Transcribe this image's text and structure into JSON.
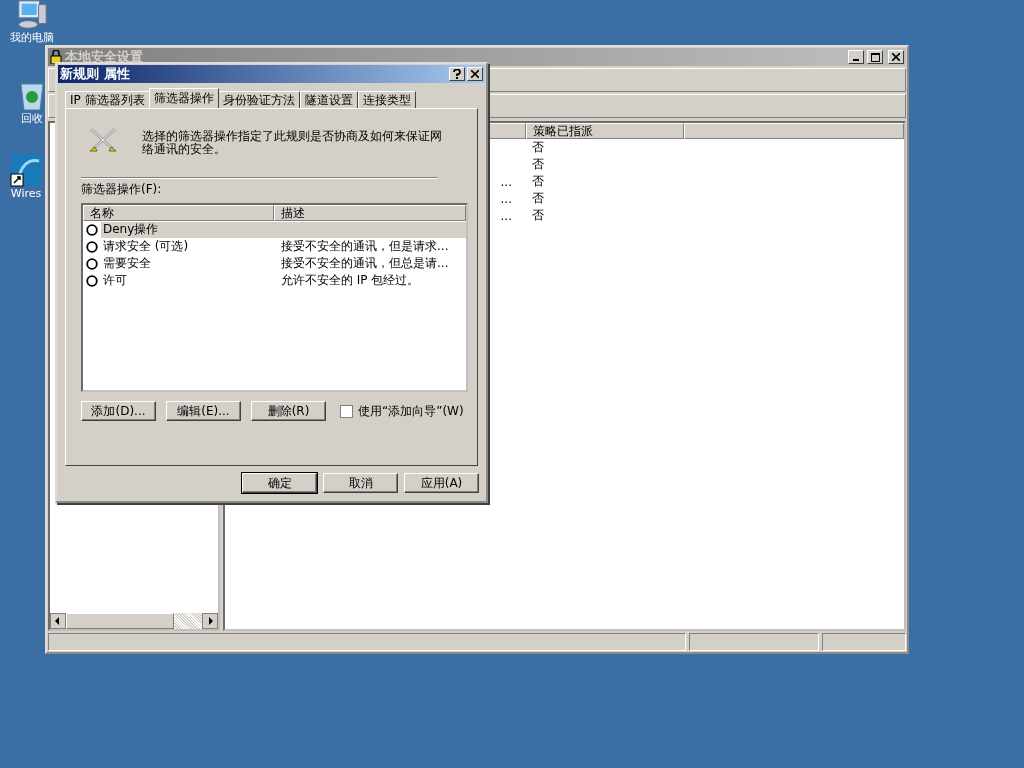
{
  "desktop_icons": [
    {
      "kind": "computer",
      "label": "我的电脑"
    },
    {
      "kind": "recycle",
      "label": "回收"
    },
    {
      "kind": "shark",
      "label": "Wires"
    }
  ],
  "main_window": {
    "title": "本地安全设置",
    "table": {
      "columns": [
        "策略已指派"
      ],
      "rows": [
        {
          "column_1": "",
          "assigned": "否"
        },
        {
          "column_1": "",
          "assigned": "否"
        },
        {
          "column_1": "...",
          "assigned": "否"
        },
        {
          "column_1": "...",
          "assigned": "否"
        },
        {
          "column_1": "...",
          "assigned": "否"
        }
      ]
    }
  },
  "dialog": {
    "title": "新规则 属性",
    "tabs": [
      {
        "label": "IP 筛选器列表",
        "selected": false
      },
      {
        "label": "筛选器操作",
        "selected": true
      },
      {
        "label": "身份验证方法",
        "selected": false
      },
      {
        "label": "隧道设置",
        "selected": false
      },
      {
        "label": "连接类型",
        "selected": false
      }
    ],
    "description": "选择的筛选器操作指定了此规则是否协商及如何来保证网络通讯的安全。",
    "list_label": "筛选器操作(F):",
    "columns": [
      "名称",
      "描述"
    ],
    "rows": [
      {
        "name": "Deny操作",
        "description": "",
        "checked": false,
        "selected": true
      },
      {
        "name": "请求安全 (可选)",
        "description": "接受不安全的通讯，但是请求...",
        "checked": false,
        "selected": false
      },
      {
        "name": "需要安全",
        "description": "接受不安全的通讯，但总是请...",
        "checked": false,
        "selected": false
      },
      {
        "name": "许可",
        "description": "允许不安全的 IP 包经过。",
        "checked": false,
        "selected": false
      }
    ],
    "list_buttons": [
      "添加(D)...",
      "编辑(E)...",
      "删除(R)"
    ],
    "wizard_checkbox": {
      "label": "使用“添加向导”(W)",
      "checked": false
    },
    "buttons": [
      {
        "label": "确定",
        "default": true
      },
      {
        "label": "取消",
        "default": false
      },
      {
        "label": "应用(A)",
        "default": false
      }
    ]
  }
}
